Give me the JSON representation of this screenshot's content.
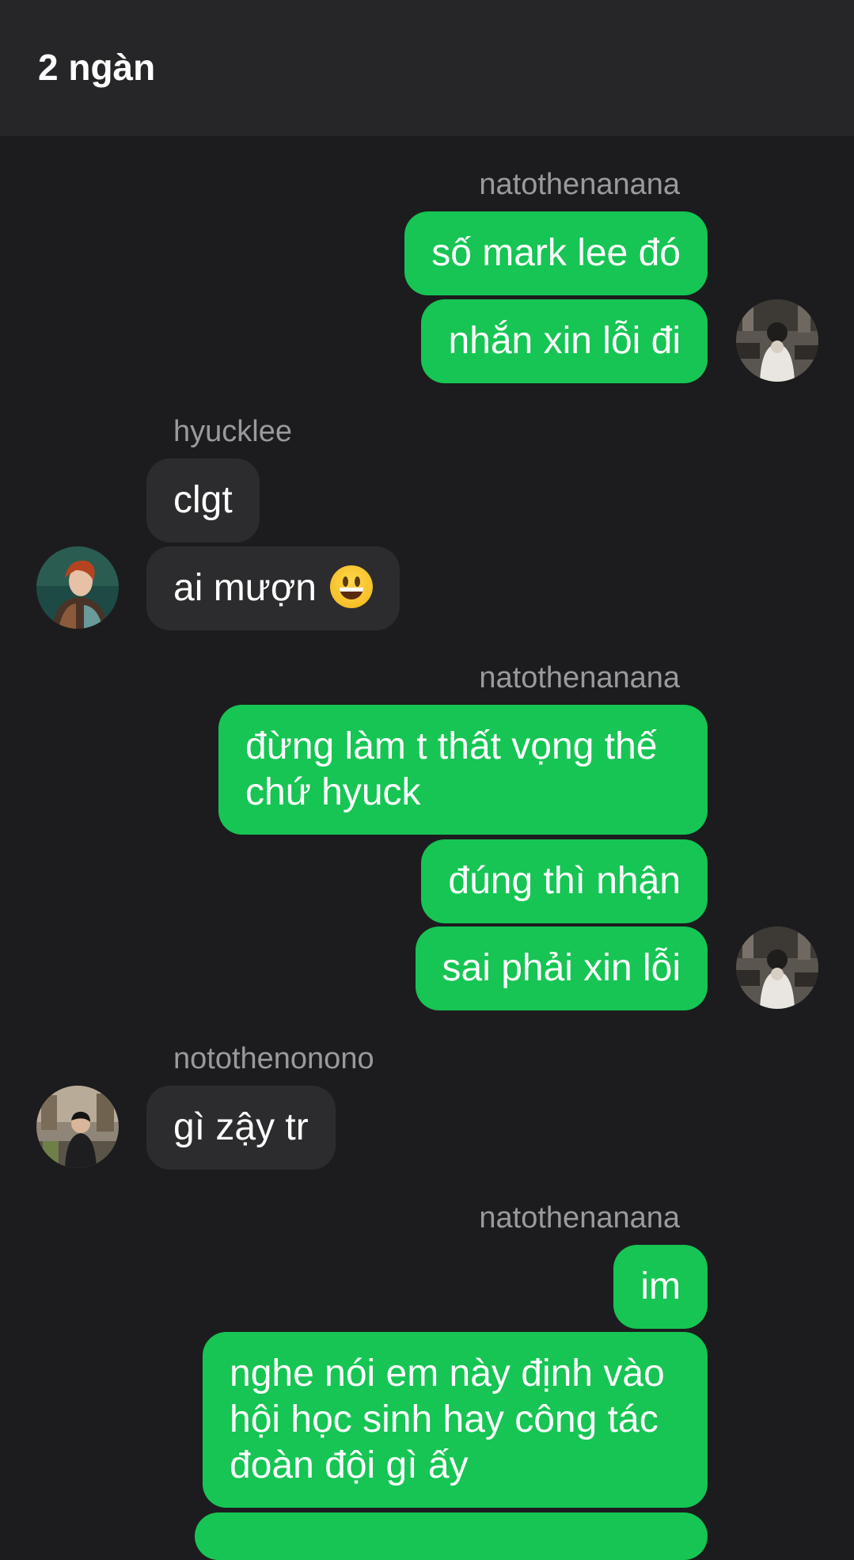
{
  "header": {
    "title": "2 ngàn"
  },
  "colors": {
    "outgoing_bubble": "#16c553",
    "incoming_bubble": "#2c2c2e",
    "background": "#1c1c1e"
  },
  "messages": {
    "g1": {
      "sender": "natothenanana",
      "m1": "số mark lee đó",
      "m2": "nhắn xin lỗi đi"
    },
    "g2": {
      "sender": "hyucklee",
      "m1": "clgt",
      "m2": "ai mượn",
      "m2_emoji": "grinning-face-emoji"
    },
    "g3": {
      "sender": "natothenanana",
      "m1_l1": "đừng làm t thất vọng thế",
      "m1_l2": "chứ hyuck",
      "m2": "đúng thì nhận",
      "m3": "sai phải xin lỗi"
    },
    "g4": {
      "sender": "notothenonono",
      "m1": "gì zậy tr"
    },
    "g5": {
      "sender": "natothenanana",
      "m1": "im",
      "m2_l1": "nghe nói em này định vào",
      "m2_l2": "hội học sinh hay công tác",
      "m2_l3": "đoàn đội gì ấy"
    }
  }
}
